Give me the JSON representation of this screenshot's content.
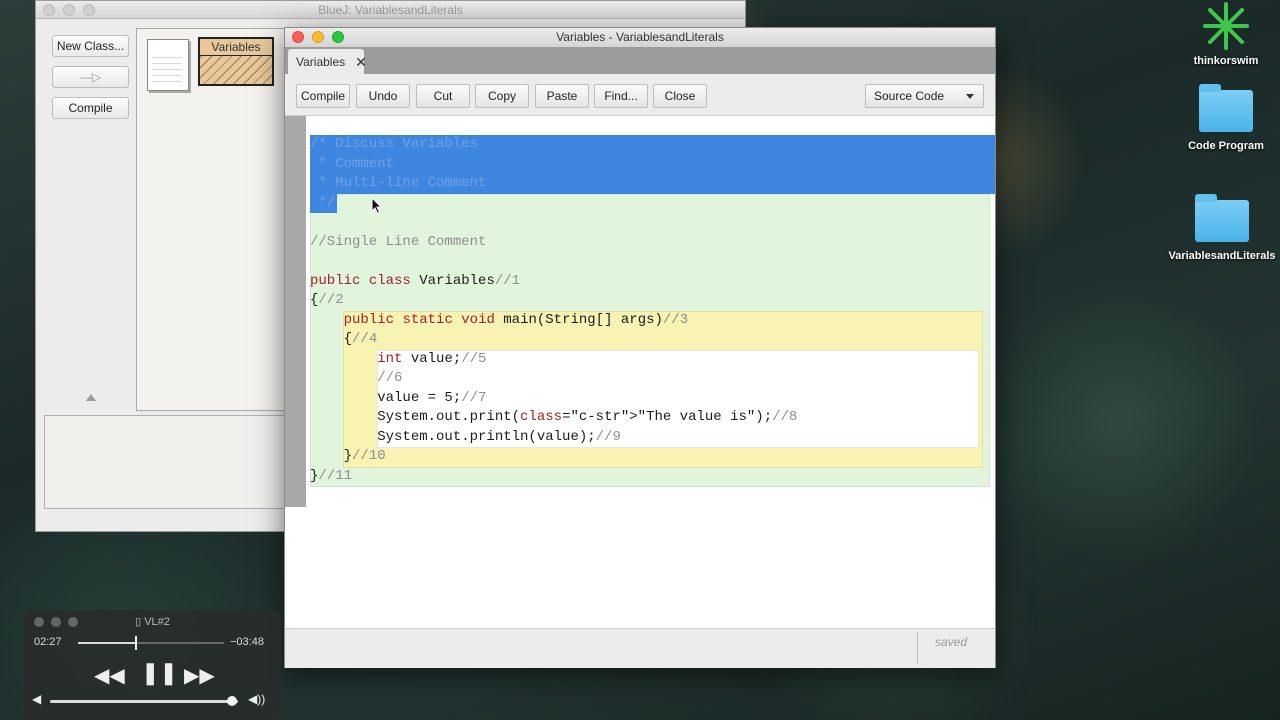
{
  "bluej": {
    "title": "BlueJ:  VariablesandLiterals",
    "new_class_label": "New Class...",
    "arrow_label": "—▷",
    "compile_label": "Compile",
    "class_name": "Variables"
  },
  "editor": {
    "title": "Variables - VariablesandLiterals",
    "tab_label": "Variables",
    "tab_close": "✕",
    "toolbar": {
      "compile": "Compile",
      "undo": "Undo",
      "cut": "Cut",
      "copy": "Copy",
      "paste": "Paste",
      "find": "Find...",
      "close": "Close"
    },
    "view_select": "Source Code",
    "status": "saved"
  },
  "code_lines": [
    "/* Discuss Variables",
    " * Comment",
    " * Multi-line Comment",
    " */",
    "",
    "//Single Line Comment",
    "",
    "public class Variables//1",
    "{//2",
    "    public static void main(String[] args)//3",
    "    {//4",
    "        int value;//5",
    "        //6",
    "        value = 5;//7",
    "        System.out.print(\"The value is\");//8",
    "        System.out.println(value);//9",
    "    }//10",
    "}//11"
  ],
  "desktop": {
    "app_label": "thinkorswim",
    "folder1": "Code Program",
    "folder2": "VariablesandLiterals"
  },
  "player": {
    "title": "VL#2",
    "elapsed": "02:27",
    "remaining": "−03:48",
    "progress_fraction": 0.39,
    "volume_fraction": 0.97
  },
  "colors": {
    "selection": "#3f86e0",
    "keyword": "#a5202a",
    "string": "#3a8a20",
    "comment": "#8e8e8e"
  }
}
